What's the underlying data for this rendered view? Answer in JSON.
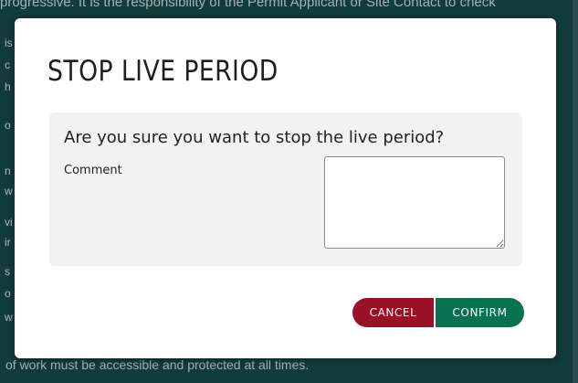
{
  "background": {
    "top_text": "progressive. It is the responsibility of the Permit Applicant or Site Contact to check",
    "bottom_text": "of work must be accessible and protected at all times.",
    "edge_fragments": [
      "is",
      "c",
      "h",
      "o",
      "n",
      "w",
      "vi",
      "ir",
      "s",
      "o",
      "w"
    ]
  },
  "modal": {
    "title": "STOP LIVE PERIOD",
    "question": "Are you sure you want to stop the live period?",
    "comment_label": "Comment",
    "comment_value": "",
    "cancel_label": "CANCEL",
    "confirm_label": "CONFIRM"
  },
  "colors": {
    "backdrop": "#123b3b",
    "cancel": "#9a1027",
    "confirm": "#0a7151",
    "panel": "#f2f2f2"
  }
}
